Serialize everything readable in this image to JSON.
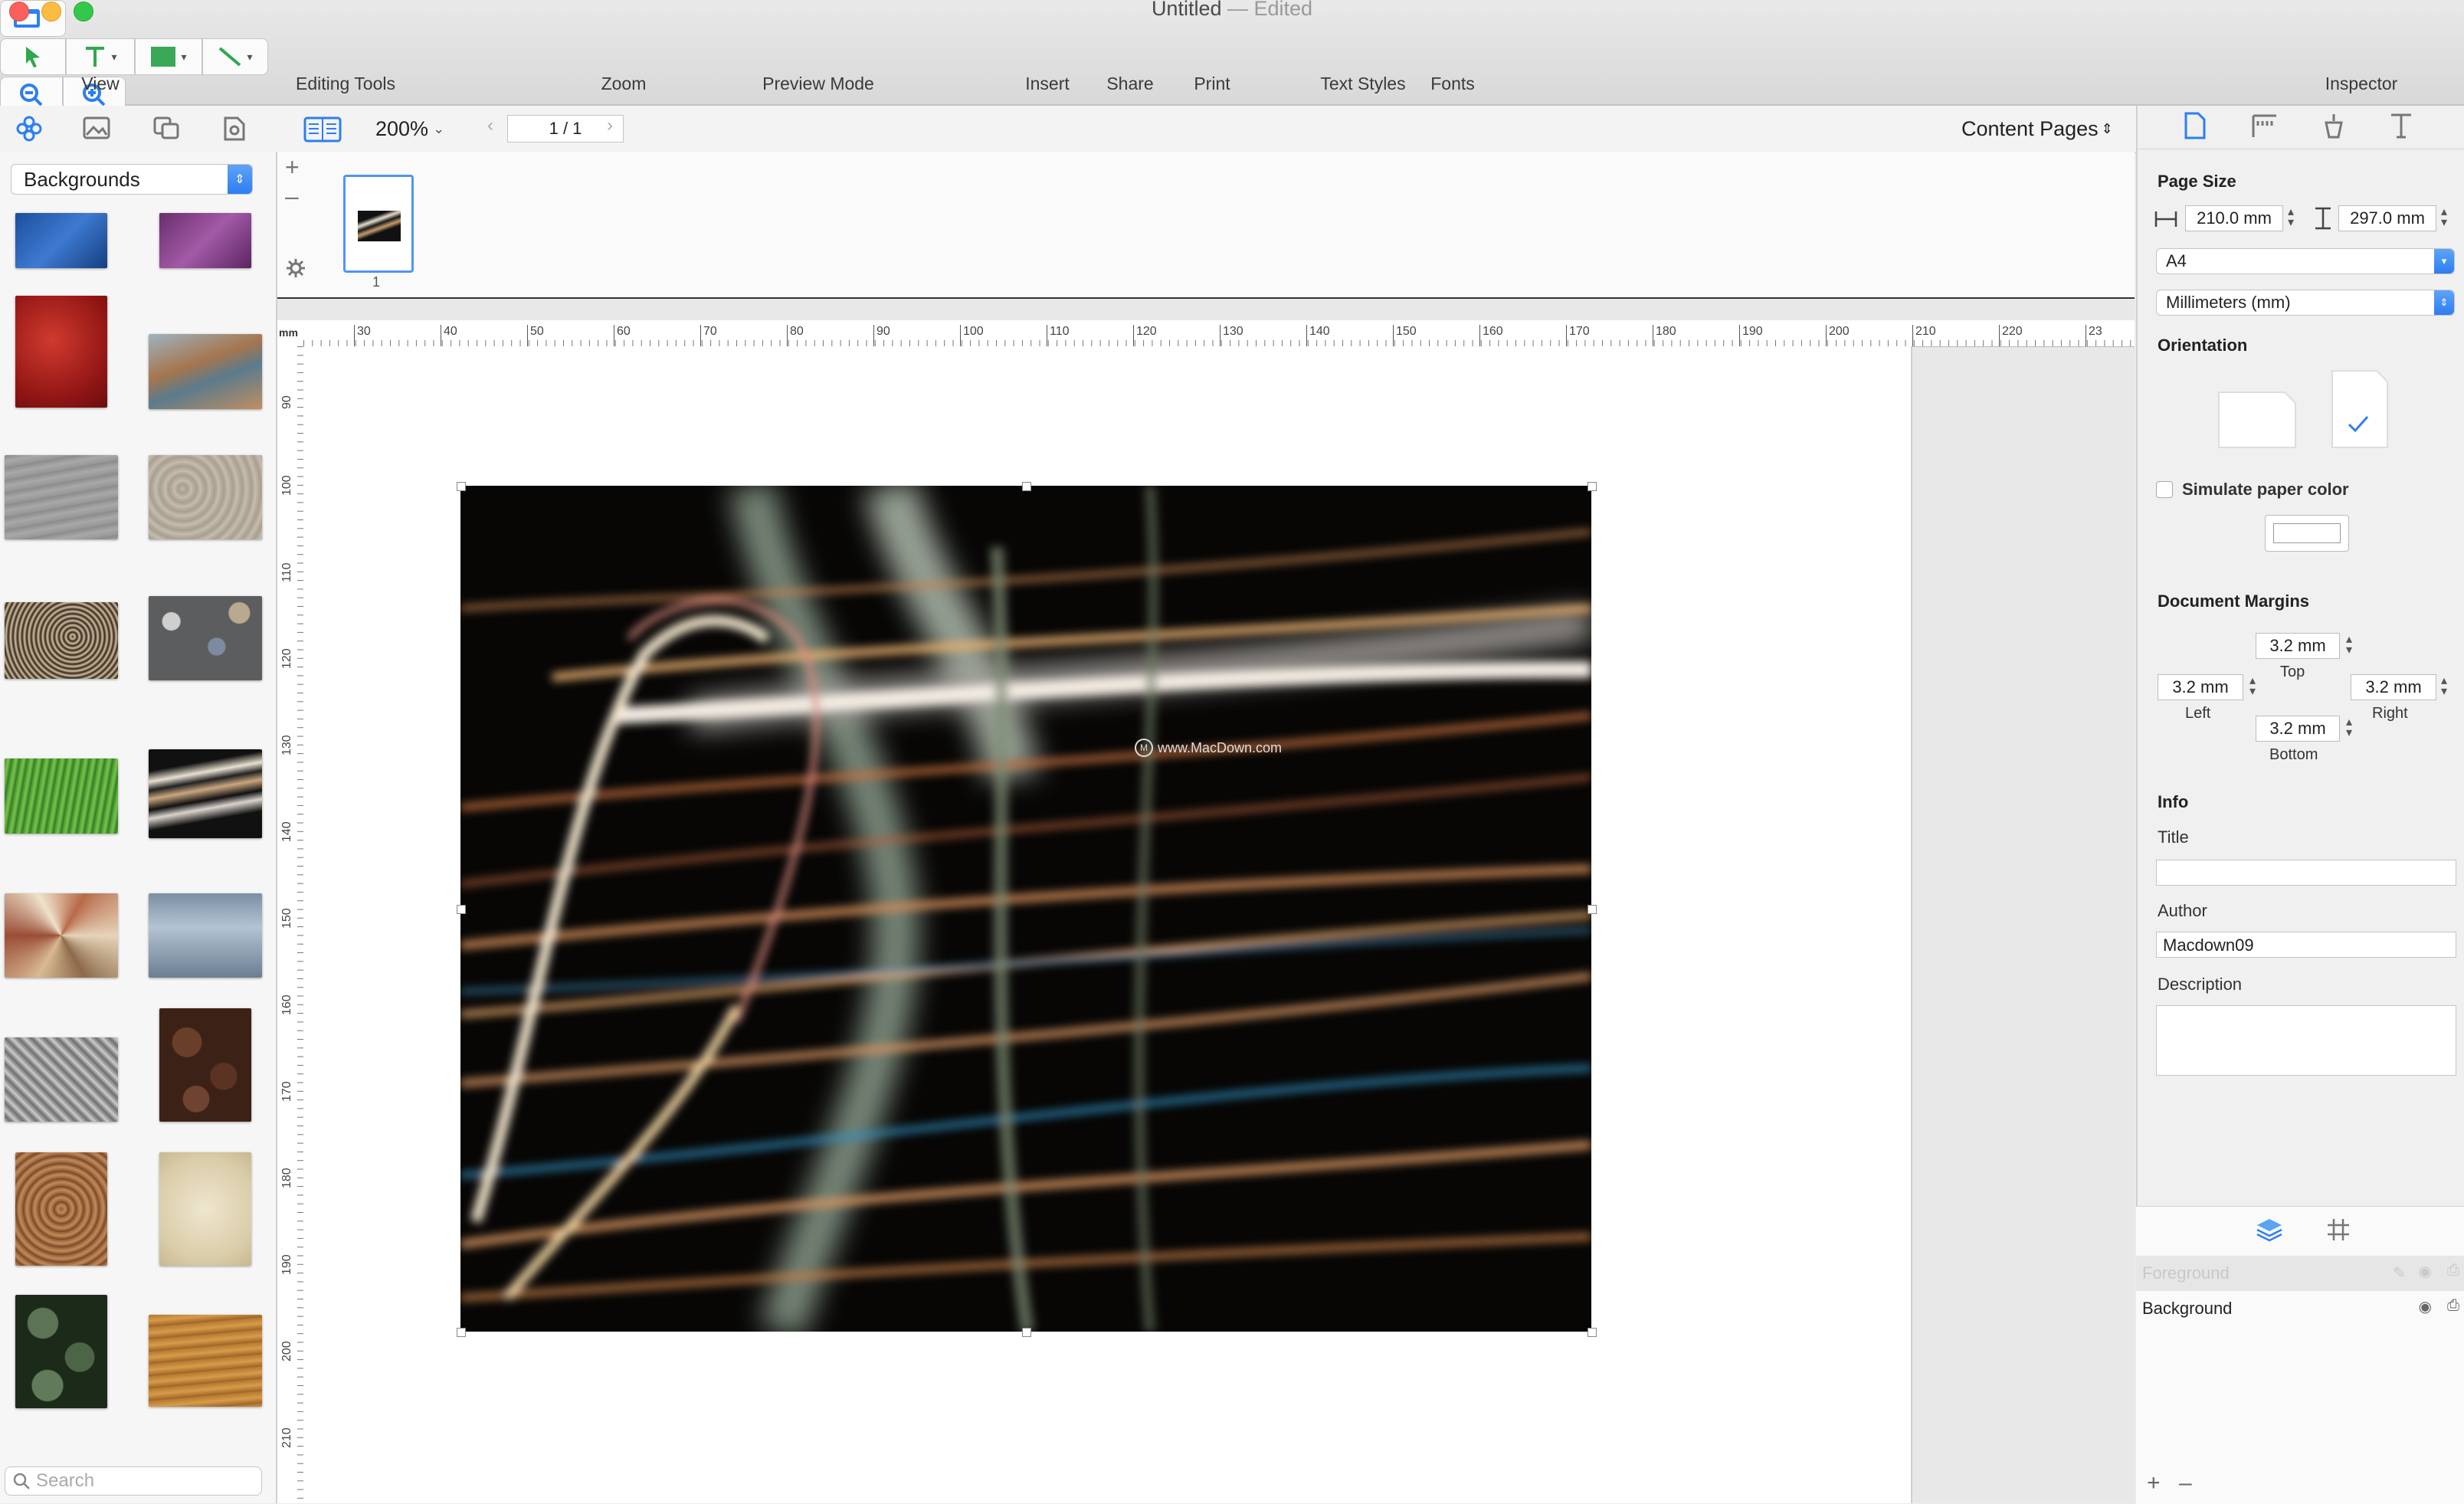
{
  "window": {
    "title": "Untitled",
    "subtitle": "— Edited"
  },
  "toolbar": {
    "view_label": "View",
    "editing_tools_label": "Editing Tools",
    "zoom_label": "Zoom",
    "preview_label": "Preview Mode",
    "insert_label": "Insert",
    "share_label": "Share",
    "print_label": "Print",
    "text_styles_label": "Text Styles",
    "fonts_label": "Fonts",
    "inspector_label": "Inspector"
  },
  "subbar": {
    "zoom_value": "200%",
    "page_indicator": "1 / 1",
    "content_pages": "Content Pages"
  },
  "sidebar": {
    "category": "Backgrounds",
    "search_placeholder": "Search"
  },
  "pages": {
    "page_number": "1"
  },
  "ruler": {
    "unit": "mm",
    "h_ticks": [
      "30",
      "40",
      "50",
      "60",
      "70",
      "80",
      "90",
      "100",
      "110",
      "120",
      "130",
      "140",
      "150",
      "160",
      "170",
      "180",
      "190",
      "200",
      "210",
      "220",
      "23"
    ],
    "v_ticks": [
      "90",
      "100",
      "110",
      "120",
      "130",
      "140",
      "150",
      "160",
      "170",
      "180",
      "190",
      "200",
      "210"
    ]
  },
  "watermark": "www.MacDown.com",
  "inspector": {
    "page_size_title": "Page Size",
    "width": "210.0 mm",
    "height": "297.0 mm",
    "paper": "A4",
    "units": "Millimeters (mm)",
    "orientation_title": "Orientation",
    "simulate_paper_color": "Simulate paper color",
    "margins_title": "Document Margins",
    "margin_top": "3.2 mm",
    "margin_top_label": "Top",
    "margin_left": "3.2 mm",
    "margin_left_label": "Left",
    "margin_right": "3.2 mm",
    "margin_right_label": "Right",
    "margin_bottom": "3.2 mm",
    "margin_bottom_label": "Bottom",
    "info_title": "Info",
    "title_label": "Title",
    "title_value": "",
    "author_label": "Author",
    "author_value": "Macdown09",
    "description_label": "Description",
    "description_value": ""
  },
  "layers": {
    "foreground": "Foreground",
    "background": "Background"
  },
  "colors": {
    "accent": "#2d7ef2",
    "canvas": "#e8e8e8",
    "photo_bg": "#050403"
  }
}
